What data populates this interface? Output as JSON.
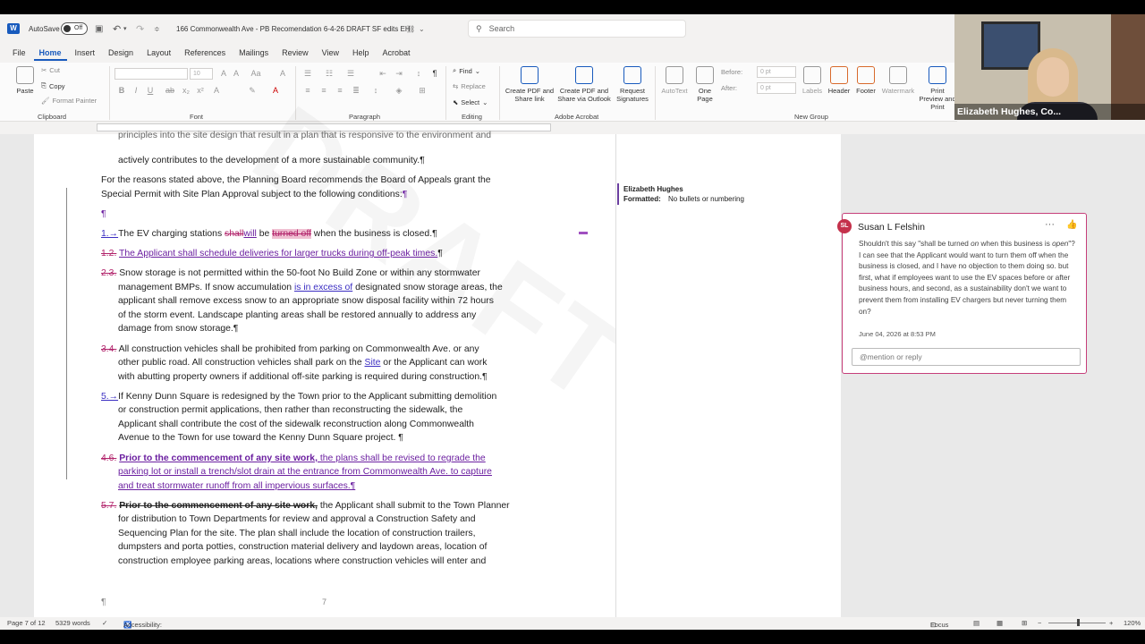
{
  "titlebar": {
    "autosave_label": "AutoSave",
    "autosave_state": "Off",
    "document_title": "166 Commonwealth Ave - PB Recomendation 6-4-26 DRAFT SF edits EH",
    "search_placeholder": "Search"
  },
  "menu": {
    "tabs": [
      "File",
      "Home",
      "Insert",
      "Design",
      "Layout",
      "References",
      "Mailings",
      "Review",
      "View",
      "Help",
      "Acrobat"
    ],
    "active": "Home"
  },
  "ribbon": {
    "clipboard": {
      "label": "Clipboard",
      "paste": "Paste",
      "cut": "Cut",
      "copy": "Copy",
      "format_painter": "Format Painter"
    },
    "font": {
      "label": "Font",
      "size": "10"
    },
    "paragraph": {
      "label": "Paragraph"
    },
    "editing": {
      "label": "Editing",
      "find": "Find",
      "replace": "Replace",
      "select": "Select"
    },
    "acrobat": {
      "label": "Adobe Acrobat",
      "create_pdf_share": "Create PDF and Share link",
      "create_pdf_outlook": "Create PDF and Share via Outlook",
      "request_signatures": "Request Signatures"
    },
    "new_group": {
      "label": "New Group",
      "autotext": "AutoText",
      "one_page": "One Page",
      "before_label": "Before:",
      "before_value": "0 pt",
      "after_label": "After:",
      "after_value": "0 pt",
      "labels": "Labels",
      "header": "Header",
      "footer": "Footer",
      "watermark": "Watermark",
      "print_preview": "Print Preview and Print"
    }
  },
  "document": {
    "line_top": "principles into the site design that result in a plan that is responsive to the environment and",
    "line_intro": "actively contributes to the development of a more sustainable community.¶",
    "para_reasons_1": "For the reasons stated above, the Planning Board recommends the Board of Appeals grant the",
    "para_reasons_2": "Special Permit with Site Plan Approval subject to the following conditions:",
    "pilcrow": "¶",
    "item1_num": "1.→",
    "item1_a": "The EV charging stations ",
    "item1_del1": "shall",
    "item1_ins1": "will",
    "item1_b": " be ",
    "item1_del2": "turned off",
    "item1_c": " when the business is closed.¶",
    "item2_num": "1.2.",
    "item2_text": "The Applicant shall schedule deliveries for larger trucks during off-peak times.",
    "item3_num": "2.3.",
    "item3_l1": "Snow storage is not permitted within the 50-foot No Build Zone or within any stormwater",
    "item3_l2a": "management BMPs. If snow accumulation ",
    "item3_l2ins": "is in excess of",
    "item3_l2b": " designated snow storage areas, the",
    "item3_l3": "applicant shall remove excess snow to an appropriate snow disposal facility within 72 hours",
    "item3_l4": "of the storm event. Landscape planting areas shall be restored annually to address any",
    "item3_l5": "damage from snow storage.¶",
    "item4_num": "3.4.",
    "item4_l1": "All construction vehicles shall be prohibited from parking on Commonwealth Ave. or any",
    "item4_l2a": "other public road. All construction vehicles shall park on the ",
    "item4_l2ins": "Site",
    "item4_l2b": " or the Applicant can work",
    "item4_l3": "with abutting property owners if additional off-site parking is required during construction.¶",
    "item5_num": "5.→",
    "item5_l1": "If Kenny Dunn Square is redesigned by the Town prior to the Applicant submitting demolition",
    "item5_l2": "or construction permit applications, then rather than reconstructing the sidewalk, the",
    "item5_l3": "Applicant shall contribute the cost of the sidewalk reconstruction along Commonwealth",
    "item5_l4": "Avenue to the Town for use toward the Kenny Dunn Square project. ¶",
    "item6_num": "4.6.",
    "item6_bold": "Prior to the commencement of any site work,",
    "item6_l1b": " the plans shall be revised to regrade the",
    "item6_l2": "parking lot or install a trench/slot drain at the entrance from Commonwealth Ave. to capture",
    "item6_l3": "and treat stormwater runoff from all impervious surfaces.¶",
    "item7_num": "5.7.",
    "item7_bold": "Prior to the commencement of any site work,",
    "item7_l1b": " the Applicant shall submit to the Town Planner",
    "item7_l2": "for distribution to Town Departments for review and approval a Construction Safety and",
    "item7_l3": "Sequencing Plan for the site. The plan shall include the location of construction trailers,",
    "item7_l4": "dumpsters and porta potties, construction material delivery and laydown areas, location of",
    "item7_l5": "construction employee parking areas, locations where construction vehicles will enter and",
    "page_number": "7"
  },
  "balloon": {
    "author": "Elizabeth Hughes",
    "label": "Formatted:",
    "value": "No bullets or numbering"
  },
  "comment": {
    "initials": "SL",
    "author": "Susan L Felshin",
    "body_1": "Shouldn't this say \"shall be turned ",
    "body_on": "on",
    "body_2": " when this business is ",
    "body_open": "open",
    "body_3": "\"? I can see that the Applicant would want to turn them off when the business is closed, and I have no objection to them doing so. but first, what if employees want to use the EV spaces before or after business hours, and second, as a sustainability don't we want to prevent them from installing EV chargers but never turning them on?",
    "date": "June 04, 2026 at 8:53 PM",
    "reply_placeholder": "@mention or reply"
  },
  "statusbar": {
    "page": "Page 7 of 12",
    "words": "5329 words",
    "accessibility": "Accessibility: Good to go",
    "focus": "Focus",
    "zoom": "120%"
  },
  "video": {
    "participant_name": "Elizabeth Hughes, Co..."
  }
}
